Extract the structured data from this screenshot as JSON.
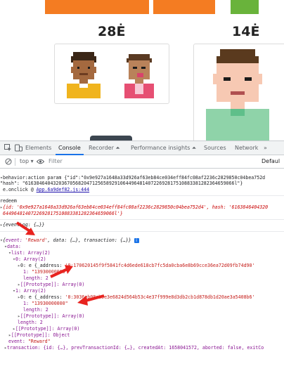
{
  "page": {
    "price_left": "28Ė",
    "price_right": "14Ė"
  },
  "colors": {
    "orange_bar": "#f47c22",
    "green_bar": "#69b33b",
    "annotation_arrow": "#e8231f"
  },
  "devtools": {
    "tabs": [
      "Elements",
      "Console",
      "Recorder ⏶",
      "Performance insights ⏶",
      "Sources",
      "Network",
      "»"
    ],
    "toolbar": {
      "context": "top ▾",
      "filter_placeholder": "Filter",
      "levels": "Defaul"
    },
    "console": {
      "line1_prefix": "behavior:action param ",
      "line1_text": "{\"id\":\"0x9e927a1648a33d926af63eb84ce034eff84fc08af2236c2829850c04bea752d",
      "line2_text": "\"hash\": \"616384640432036705682047125658929106449648140722692817510883381282364659066l\"}",
      "line3_prefix": "e.onclick @ ",
      "line3_link": "App.6a9def82.js:444",
      "redeem": "redeem",
      "line5_text": "{id: '0x9e927a1648a33d926af63eb84ce034eff84fc08af2236c2829850c04bea752d4', hash: '6163846404320",
      "line6_text": "6449648140722692817510883381282364659066l'}",
      "line7_text": "{eventLog: {…}}",
      "obj_head_key1": "event:",
      "obj_head_val1": "'Reward'",
      "obj_head_rest": ", data: {…}, transaction: {…}}",
      "data_label": "data:",
      "list_label": "list: Array(2)",
      "idx0_label": "0: Array(2)",
      "idx0_0_prefix": "0: e {_address: ",
      "idx0_0_addr": "'0:170620145f9f5841fc4d6ede618cb7fc5da0cba6e8b69cce36ea72d09fb74d90'",
      "idx0_1_key": "1:",
      "idx0_1_val": "\"13930000000\"",
      "length2a": "length: 2",
      "proto_array_a": "[[Prototype]]: Array(0)",
      "idx1_label": "1: Array(2)",
      "idx1_0_prefix": "0: e {_address: ",
      "idx1_0_addr": "'0:3036eb08ab5e3e6824d564b53c4e37f999e8d3db2cb1d878db1d20ae3a5408b6'",
      "idx1_1_key": "1:",
      "idx1_1_val": "\"13930000000\"",
      "length2b": "length: 2",
      "proto_array_b": "[[Prototype]]: Array(0)",
      "length2c": "length: 2",
      "proto_array_c": "[[Prototype]]: Array(0)",
      "proto_object": "[[Prototype]]: Object",
      "event_key": "event:",
      "event_val": "\"Reward\"",
      "transaction_line": "transaction: {id: {…}, prevTransactionId: {…}, createdAt: 1658041572, aborted: false, exitCo"
    }
  }
}
